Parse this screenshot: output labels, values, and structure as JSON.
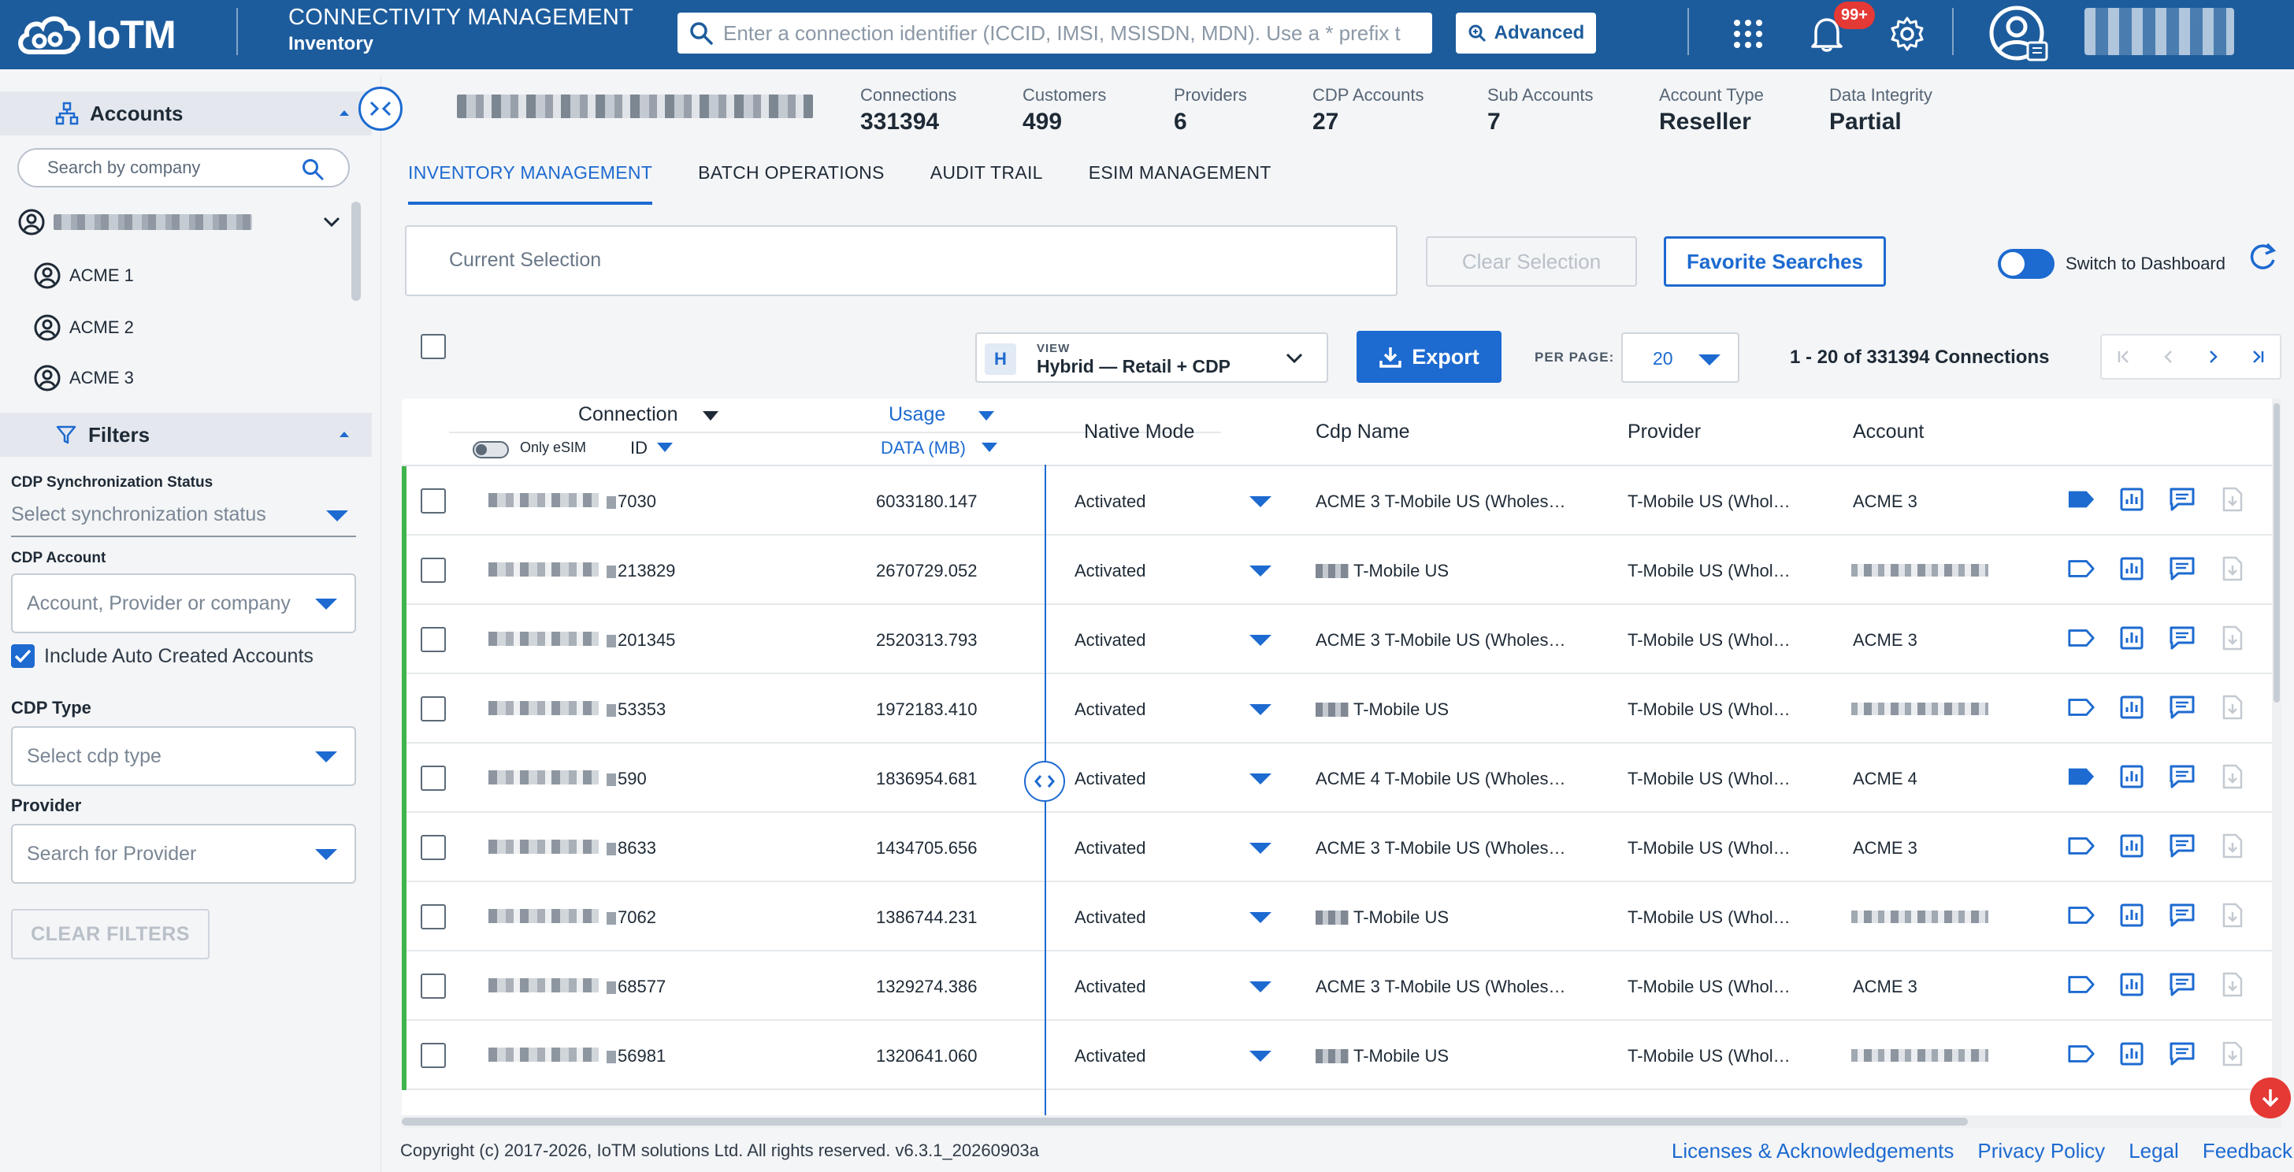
{
  "header": {
    "logo_text": "IoTM",
    "app_title": "CONNECTIVITY MANAGEMENT",
    "app_subtitle": "Inventory",
    "search_placeholder": "Enter a connection identifier (ICCID, IMSI, MSISDN, MDN). Use a * prefix to",
    "advanced_label": "Advanced",
    "notification_count": "99+",
    "icons": [
      "search-icon",
      "apps-grid-icon",
      "bell-icon",
      "gear-icon",
      "user-avatar-icon"
    ]
  },
  "sidebar": {
    "accounts_label": "Accounts",
    "company_search_placeholder": "Search by company",
    "tree": [
      {
        "label": "ACME 1"
      },
      {
        "label": "ACME 2"
      },
      {
        "label": "ACME 3"
      }
    ],
    "filters_label": "Filters",
    "cdp_sync_label": "CDP Synchronization Status",
    "cdp_sync_placeholder": "Select synchronization status",
    "cdp_account_label": "CDP Account",
    "cdp_account_placeholder": "Account, Provider or company",
    "include_auto_label": "Include Auto Created Accounts",
    "include_auto_checked": true,
    "cdp_type_label": "CDP Type",
    "cdp_type_placeholder": "Select cdp type",
    "provider_label": "Provider",
    "provider_placeholder": "Search for Provider",
    "clear_filters_label": "CLEAR FILTERS"
  },
  "stats": [
    {
      "label": "Connections",
      "value": "331394"
    },
    {
      "label": "Customers",
      "value": "499"
    },
    {
      "label": "Providers",
      "value": "6"
    },
    {
      "label": "CDP Accounts",
      "value": "27"
    },
    {
      "label": "Sub Accounts",
      "value": "7"
    },
    {
      "label": "Account Type",
      "value": "Reseller"
    },
    {
      "label": "Data Integrity",
      "value": "Partial"
    }
  ],
  "tabs": [
    {
      "label": "INVENTORY MANAGEMENT",
      "active": true
    },
    {
      "label": "BATCH OPERATIONS",
      "active": false
    },
    {
      "label": "AUDIT TRAIL",
      "active": false
    },
    {
      "label": "ESIM MANAGEMENT",
      "active": false
    }
  ],
  "selection": {
    "current_selection_label": "Current Selection",
    "clear_selection_label": "Clear Selection",
    "favorite_searches_label": "Favorite Searches",
    "switch_dashboard_label": "Switch to Dashboard"
  },
  "toolbar": {
    "view_badge": "H",
    "view_label": "VIEW",
    "view_value": "Hybrid — Retail + CDP",
    "export_label": "Export",
    "per_page_label": "PER PAGE:",
    "per_page_value": "20",
    "range_text": "1 - 20 of 331394 Connections"
  },
  "table": {
    "columns": {
      "connection": "Connection",
      "only_esim": "Only eSIM",
      "id": "ID",
      "usage": "Usage",
      "data_mb": "DATA (MB)",
      "native_mode": "Native Mode",
      "cdp_name": "Cdp Name",
      "provider": "Provider",
      "account": "Account"
    },
    "rows": [
      {
        "id_suffix": "7030",
        "usage": "6033180.147",
        "mode": "Activated",
        "cdp_name": "ACME 3 T-Mobile US (Wholes…",
        "cdp_blur": false,
        "provider": "T-Mobile US (Whol…",
        "account": "ACME 3",
        "account_blur": false,
        "tag_filled": true
      },
      {
        "id_suffix": "213829",
        "usage": "2670729.052",
        "mode": "Activated",
        "cdp_name": "T-Mobile US",
        "cdp_blur": true,
        "provider": "T-Mobile US (Whol…",
        "account": "",
        "account_blur": true,
        "tag_filled": false
      },
      {
        "id_suffix": "201345",
        "usage": "2520313.793",
        "mode": "Activated",
        "cdp_name": "ACME 3 T-Mobile US (Wholes…",
        "cdp_blur": false,
        "provider": "T-Mobile US (Whol…",
        "account": "ACME 3",
        "account_blur": false,
        "tag_filled": false
      },
      {
        "id_suffix": "53353",
        "usage": "1972183.410",
        "mode": "Activated",
        "cdp_name": "T-Mobile US",
        "cdp_blur": true,
        "provider": "T-Mobile US (Whol…",
        "account": "",
        "account_blur": true,
        "tag_filled": false
      },
      {
        "id_suffix": "590",
        "usage": "1836954.681",
        "mode": "Activated",
        "cdp_name": "ACME 4 T-Mobile US (Wholes…",
        "cdp_blur": false,
        "provider": "T-Mobile US (Whol…",
        "account": "ACME 4",
        "account_blur": false,
        "tag_filled": true
      },
      {
        "id_suffix": "8633",
        "usage": "1434705.656",
        "mode": "Activated",
        "cdp_name": "ACME 3 T-Mobile US (Wholes…",
        "cdp_blur": false,
        "provider": "T-Mobile US (Whol…",
        "account": "ACME 3",
        "account_blur": false,
        "tag_filled": false
      },
      {
        "id_suffix": "7062",
        "usage": "1386744.231",
        "mode": "Activated",
        "cdp_name": "T-Mobile US",
        "cdp_blur": true,
        "provider": "T-Mobile US (Whol…",
        "account": "",
        "account_blur": true,
        "tag_filled": false
      },
      {
        "id_suffix": "68577",
        "usage": "1329274.386",
        "mode": "Activated",
        "cdp_name": "ACME 3 T-Mobile US (Wholes…",
        "cdp_blur": false,
        "provider": "T-Mobile US (Whol…",
        "account": "ACME 3",
        "account_blur": false,
        "tag_filled": false
      },
      {
        "id_suffix": "56981",
        "usage": "1320641.060",
        "mode": "Activated",
        "cdp_name": "T-Mobile US",
        "cdp_blur": true,
        "provider": "T-Mobile US (Whol…",
        "account": "",
        "account_blur": true,
        "tag_filled": false
      }
    ]
  },
  "footer": {
    "copyright": "Copyright (c) 2017-2026, IoTM solutions Ltd. All rights reserved. v6.3.1_20260903a",
    "links": [
      "Licenses & Acknowledgements",
      "Privacy Policy",
      "Legal",
      "Feedback"
    ]
  },
  "colors": {
    "header_bg": "#1d5c9c",
    "accent": "#1d6ad0",
    "row_status": "#3fb44c",
    "badge": "#e53935"
  }
}
